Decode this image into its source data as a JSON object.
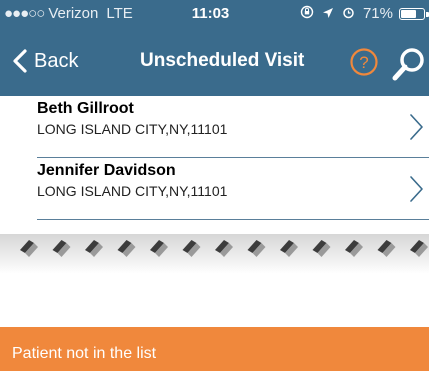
{
  "status_bar": {
    "signal_dots": "●●●○○",
    "carrier": "Verizon",
    "network": "LTE",
    "time": "11:03",
    "battery_percent": "71%",
    "battery_level": 0.71,
    "icons": [
      "rotation-lock-icon",
      "location-arrow-icon",
      "alarm-icon",
      "battery-icon"
    ]
  },
  "nav": {
    "back_label": "Back",
    "title": "Unscheduled Visit",
    "help_icon": "question-circle-icon",
    "search_icon": "magnifier-icon",
    "accent_color": "#f0883c",
    "bar_color": "#3a6b8c"
  },
  "patients": [
    {
      "name": "Beth Gillroot",
      "address": "LONG ISLAND CITY,NY,11101"
    },
    {
      "name": "Jennifer Davidson",
      "address": "LONG ISLAND CITY,NY,11101"
    }
  ],
  "footer": {
    "label": "Patient not in the list",
    "color": "#f0883c"
  }
}
